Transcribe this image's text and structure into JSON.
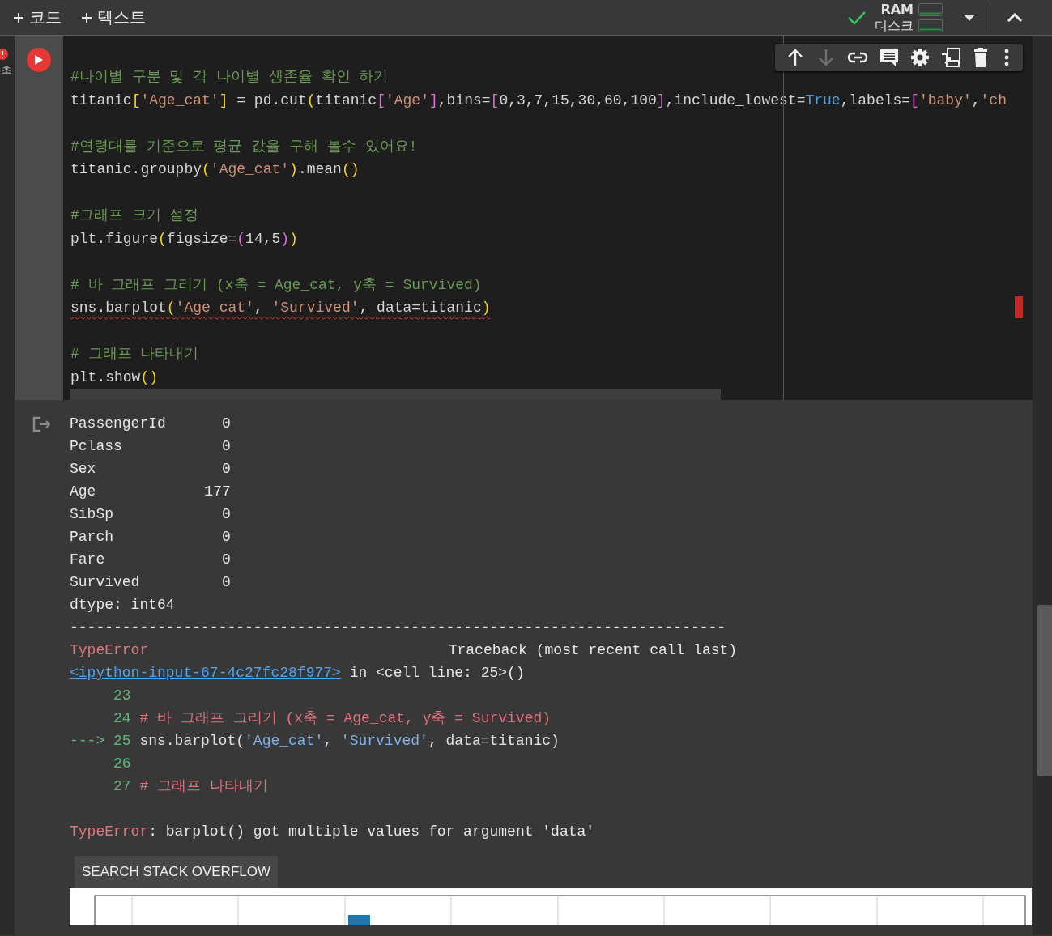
{
  "toolbar": {
    "buttons": [
      "코드",
      "텍스트"
    ]
  },
  "status": {
    "connected": true,
    "resources": [
      {
        "label": "RAM"
      },
      {
        "label": "디스크"
      }
    ]
  },
  "gutter": {
    "text": "초",
    "alert": true
  },
  "cell": {
    "failed": true,
    "error_marker": true,
    "actions": [
      {
        "kind": "up",
        "disabled": false
      },
      {
        "kind": "down",
        "disabled": true
      },
      {
        "kind": "link",
        "disabled": false
      },
      {
        "kind": "comment",
        "disabled": false
      },
      {
        "kind": "settings",
        "disabled": false
      },
      {
        "kind": "mirror",
        "disabled": false
      },
      {
        "kind": "delete",
        "disabled": false
      },
      {
        "kind": "more",
        "disabled": false
      }
    ],
    "lines": [
      {
        "kind": "code",
        "underlined": false,
        "tokens": [
          {
            "text": "#나이별 구분 및 각 나이별 생존율 확인 하기",
            "kind": "comment"
          }
        ]
      },
      {
        "kind": "code",
        "underlined": false,
        "tokens": [
          {
            "text": "titanic",
            "kind": "plain"
          },
          {
            "text": "[",
            "kind": "bracket1"
          },
          {
            "text": "'Age_cat'",
            "kind": "string"
          },
          {
            "text": "]",
            "kind": "bracket1"
          },
          {
            "text": " = pd.cut",
            "kind": "plain"
          },
          {
            "text": "(",
            "kind": "bracket1"
          },
          {
            "text": "titanic",
            "kind": "plain"
          },
          {
            "text": "[",
            "kind": "bracket2"
          },
          {
            "text": "'Age'",
            "kind": "string"
          },
          {
            "text": "]",
            "kind": "bracket2"
          },
          {
            "text": ",bins=",
            "kind": "plain"
          },
          {
            "text": "[",
            "kind": "bracket2"
          },
          {
            "text": "0,3,7,15,30,60,100",
            "kind": "plain"
          },
          {
            "text": "]",
            "kind": "bracket2"
          },
          {
            "text": ",include_lowest=",
            "kind": "plain"
          },
          {
            "text": "True",
            "kind": "keyword"
          },
          {
            "text": ",labels=",
            "kind": "plain"
          },
          {
            "text": "[",
            "kind": "bracket2"
          },
          {
            "text": "'baby'",
            "kind": "string"
          },
          {
            "text": ",",
            "kind": "plain"
          },
          {
            "text": "'ch",
            "kind": "string"
          }
        ]
      },
      {
        "kind": "blank"
      },
      {
        "kind": "code",
        "underlined": false,
        "tokens": [
          {
            "text": "#연령대를 기준으로 평균 값을 구해 볼수 있어요!",
            "kind": "comment"
          }
        ]
      },
      {
        "kind": "code",
        "underlined": false,
        "tokens": [
          {
            "text": "titanic.groupby",
            "kind": "plain"
          },
          {
            "text": "(",
            "kind": "bracket1"
          },
          {
            "text": "'Age_cat'",
            "kind": "string"
          },
          {
            "text": ")",
            "kind": "bracket1"
          },
          {
            "text": ".mean",
            "kind": "plain"
          },
          {
            "text": "()",
            "kind": "bracket1"
          }
        ]
      },
      {
        "kind": "blank"
      },
      {
        "kind": "code",
        "underlined": false,
        "tokens": [
          {
            "text": "#그래프 크기 설정",
            "kind": "comment"
          }
        ]
      },
      {
        "kind": "code",
        "underlined": false,
        "tokens": [
          {
            "text": "plt.figure",
            "kind": "plain"
          },
          {
            "text": "(",
            "kind": "bracket1"
          },
          {
            "text": "figsize=",
            "kind": "plain"
          },
          {
            "text": "(",
            "kind": "bracket2"
          },
          {
            "text": "14,5",
            "kind": "plain"
          },
          {
            "text": ")",
            "kind": "bracket2"
          },
          {
            "text": ")",
            "kind": "bracket1"
          }
        ]
      },
      {
        "kind": "blank"
      },
      {
        "kind": "code",
        "underlined": false,
        "tokens": [
          {
            "text": "# 바 그래프 그리기 (x축 = Age_cat, y축 = Survived)",
            "kind": "comment"
          }
        ]
      },
      {
        "kind": "code",
        "underlined": true,
        "tokens": [
          {
            "text": "sns.barplot",
            "kind": "plain"
          },
          {
            "text": "(",
            "kind": "bracket1"
          },
          {
            "text": "'Age_cat'",
            "kind": "string"
          },
          {
            "text": ", ",
            "kind": "plain"
          },
          {
            "text": "'Survived'",
            "kind": "string"
          },
          {
            "text": ", data=titanic",
            "kind": "plain"
          },
          {
            "text": ")",
            "kind": "bracket1"
          }
        ]
      },
      {
        "kind": "blank"
      },
      {
        "kind": "code",
        "underlined": false,
        "tokens": [
          {
            "text": "# 그래프 나타내기",
            "kind": "comment"
          }
        ]
      },
      {
        "kind": "code",
        "underlined": false,
        "tokens": [
          {
            "text": "plt.show",
            "kind": "plain"
          },
          {
            "text": "()",
            "kind": "bracket1"
          }
        ]
      }
    ]
  },
  "output": {
    "series": [
      {
        "name": "PassengerId",
        "value": "0"
      },
      {
        "name": "Pclass",
        "value": "0"
      },
      {
        "name": "Sex",
        "value": "0"
      },
      {
        "name": "Age",
        "value": "177"
      },
      {
        "name": "SibSp",
        "value": "0"
      },
      {
        "name": "Parch",
        "value": "0"
      },
      {
        "name": "Fare",
        "value": "0"
      },
      {
        "name": "Survived",
        "value": "0"
      }
    ],
    "dtype": "dtype: int64",
    "rule": "---------------------------------------------------------------------------",
    "traceback": {
      "error_name": "TypeError",
      "header": "Traceback (most recent call last)",
      "link": "<ipython-input-67-4c27fc28f977>",
      "location": "in <cell line: 25>()",
      "source": [
        {
          "lineno": "23"
        },
        {
          "lineno": "24",
          "tokens": [
            {
              "text": "# 바 그래프 그리기 (x축 = Age_cat, y축 = Survived)",
              "kind": "comment"
            }
          ]
        },
        {
          "lineno": "25",
          "arrow": "--->",
          "tokens": [
            {
              "text": "sns.barplot(",
              "kind": "plain"
            },
            {
              "text": "'Age_cat'",
              "kind": "string"
            },
            {
              "text": ", ",
              "kind": "plain"
            },
            {
              "text": "'Survived'",
              "kind": "string"
            },
            {
              "text": ", data=titanic)",
              "kind": "plain"
            }
          ]
        },
        {
          "lineno": "26"
        },
        {
          "lineno": "27",
          "tokens": [
            {
              "text": "# 그래프 나타내기",
              "kind": "comment"
            }
          ]
        }
      ]
    },
    "message": {
      "error_name": "TypeError",
      "text": ": barplot() got multiple values for argument 'data'"
    },
    "button": "SEARCH STACK OVERFLOW"
  }
}
